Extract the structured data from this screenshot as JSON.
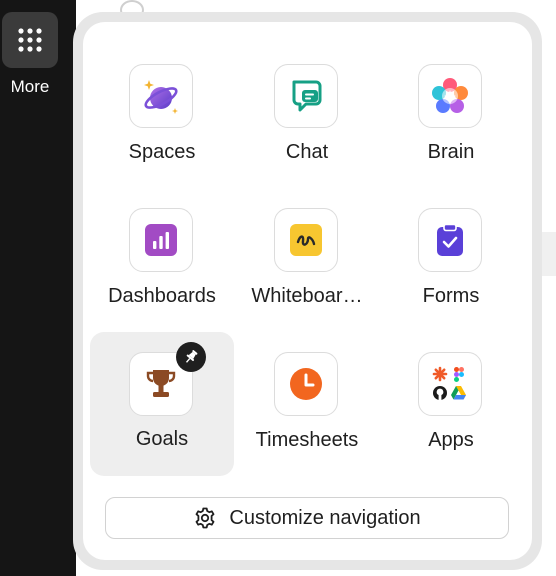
{
  "rail": {
    "more_label": "More"
  },
  "menu": {
    "items": [
      {
        "label": "Spaces",
        "icon": "planet-icon"
      },
      {
        "label": "Chat",
        "icon": "chat-icon"
      },
      {
        "label": "Brain",
        "icon": "brain-icon"
      },
      {
        "label": "Dashboards",
        "icon": "dashboards-icon"
      },
      {
        "label": "Whiteboar…",
        "icon": "whiteboard-icon"
      },
      {
        "label": "Forms",
        "icon": "forms-icon"
      },
      {
        "label": "Goals",
        "icon": "trophy-icon",
        "pinned": true,
        "hovered": true
      },
      {
        "label": "Timesheets",
        "icon": "clock-icon"
      },
      {
        "label": "Apps",
        "icon": "apps-icon"
      }
    ],
    "customize_label": "Customize navigation"
  },
  "colors": {
    "rail_bg": "#151515",
    "chat_teal": "#16a085",
    "dashboards_purple": "#a24bc4",
    "whiteboard_yellow": "#f7c630",
    "forms_indigo": "#5a40d8",
    "timesheets_orange": "#f2661f",
    "goals_brown": "#8b4a24"
  }
}
